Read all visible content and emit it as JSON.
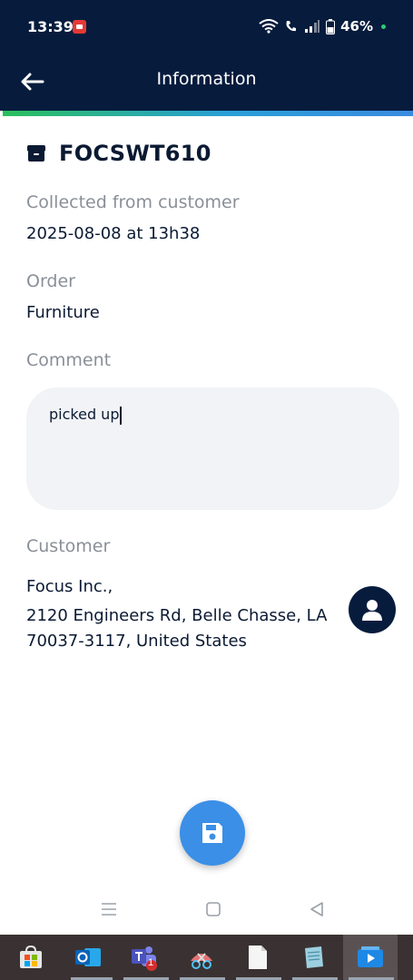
{
  "status_bar": {
    "time": "13:39",
    "battery": "46%"
  },
  "app_bar": {
    "title": "Information"
  },
  "item": {
    "code": "FOCSWT610"
  },
  "collected": {
    "label": "Collected from customer",
    "value": "2025-08-08 at 13h38"
  },
  "order": {
    "label": "Order",
    "value": "Furniture"
  },
  "comment": {
    "label": "Comment",
    "value": "picked up"
  },
  "customer": {
    "label": "Customer",
    "name": "Focus Inc.,",
    "address": "2120 Engineers Rd, Belle Chasse, LA 70037-3117, United States"
  },
  "icons": {
    "back": "arrow-left-icon",
    "item": "box-icon",
    "avatar": "person-icon",
    "save": "save-icon"
  },
  "colors": {
    "header_bg": "#071c3d",
    "accent": "#3b8fe6",
    "label_gray": "#8a8f98",
    "comment_bg": "#f1f3f6"
  },
  "taskbar": {
    "teams_badge": "1"
  }
}
